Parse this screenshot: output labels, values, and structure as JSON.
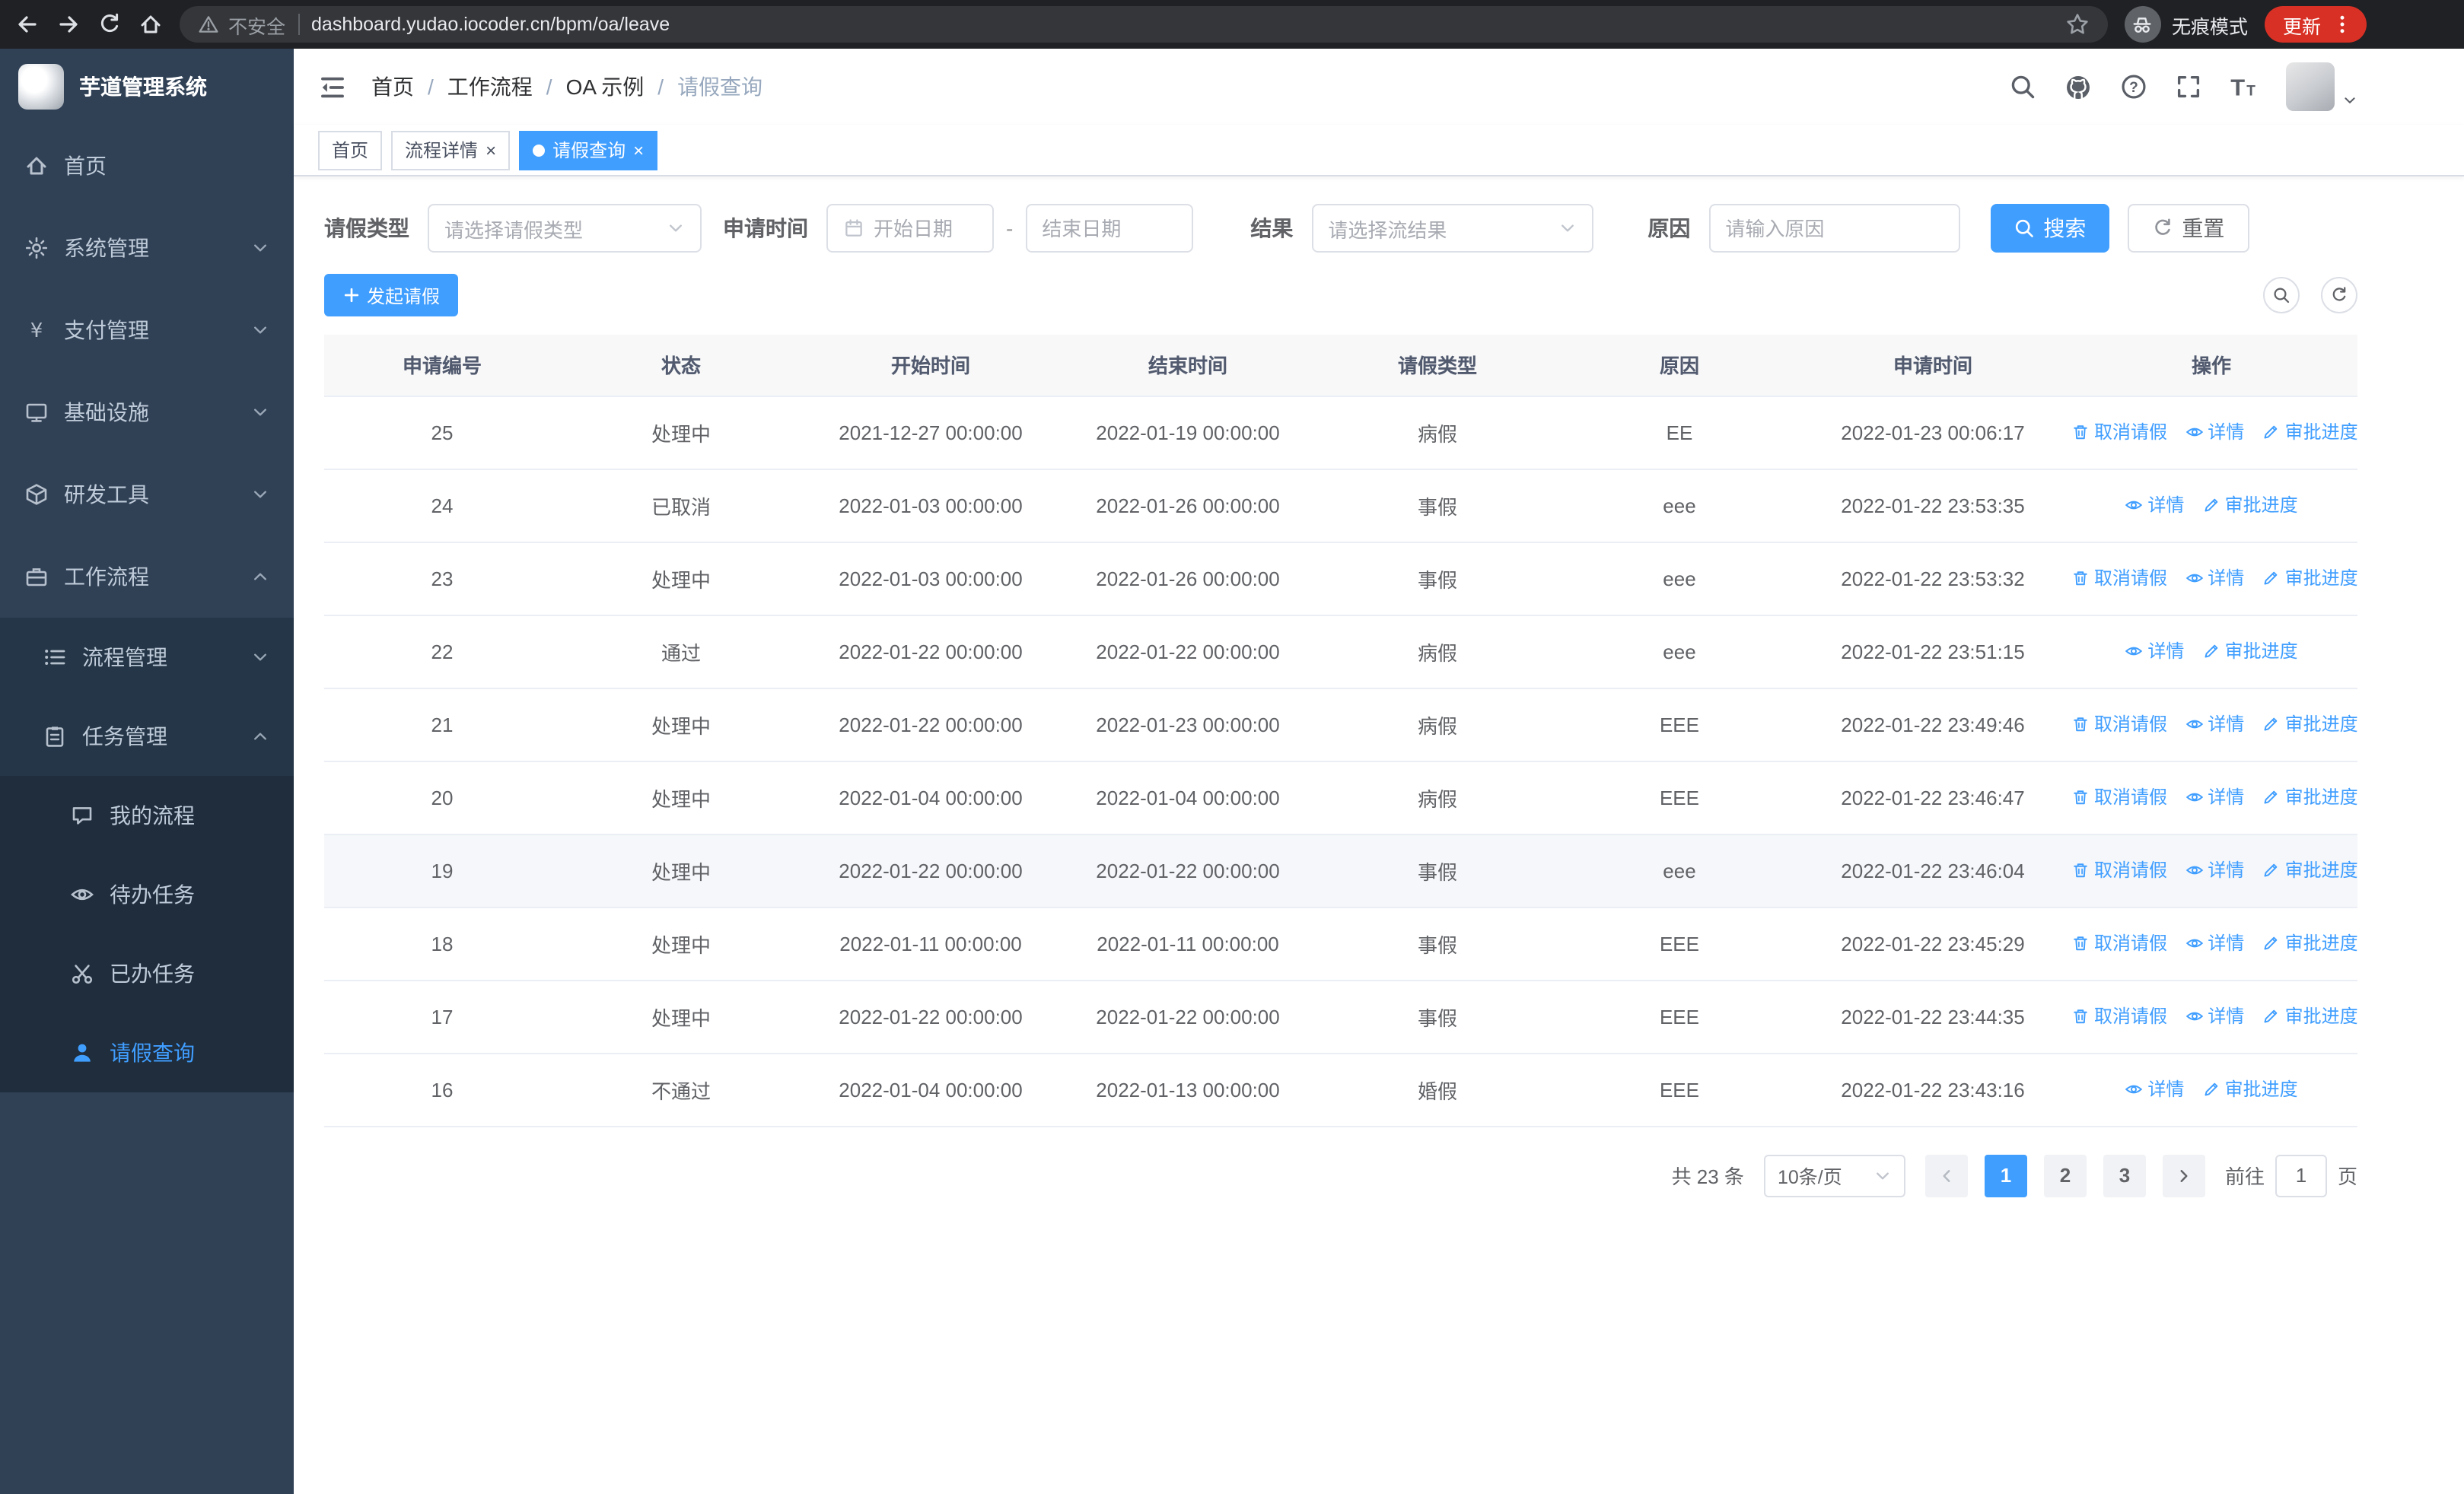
{
  "browser": {
    "security_label": "不安全",
    "url": "dashboard.yudao.iocoder.cn/bpm/oa/leave",
    "incognito_label": "无痕模式",
    "update_label": "更新"
  },
  "sidebar": {
    "logo_title": "芋道管理系统",
    "items": [
      {
        "label": "首页",
        "level": 1,
        "icon": "home-icon"
      },
      {
        "label": "系统管理",
        "level": 1,
        "icon": "gear-icon",
        "chevron": "down"
      },
      {
        "label": "支付管理",
        "level": 1,
        "icon": "yen-icon",
        "chevron": "down"
      },
      {
        "label": "基础设施",
        "level": 1,
        "icon": "monitor-icon",
        "chevron": "down"
      },
      {
        "label": "研发工具",
        "level": 1,
        "icon": "cube-icon",
        "chevron": "down"
      },
      {
        "label": "工作流程",
        "level": 1,
        "icon": "briefcase-icon",
        "chevron": "up"
      },
      {
        "label": "流程管理",
        "level": 2,
        "icon": "list-icon",
        "chevron": "down"
      },
      {
        "label": "任务管理",
        "level": 2,
        "icon": "clipboard-icon",
        "chevron": "up"
      },
      {
        "label": "我的流程",
        "level": 3,
        "icon": "chat-icon"
      },
      {
        "label": "待办任务",
        "level": 3,
        "icon": "eye-icon"
      },
      {
        "label": "已办任务",
        "level": 3,
        "icon": "scissors-icon"
      },
      {
        "label": "请假查询",
        "level": 3,
        "icon": "user-icon",
        "active": true
      }
    ]
  },
  "header": {
    "breadcrumb": [
      "首页",
      "工作流程",
      "OA 示例",
      "请假查询"
    ],
    "icons": [
      "search-icon",
      "github-icon",
      "question-icon",
      "fullscreen-icon",
      "font-size-icon",
      "avatar",
      "chevron-down-icon"
    ]
  },
  "tabs": [
    {
      "label": "首页",
      "closable": false,
      "active": false
    },
    {
      "label": "流程详情",
      "closable": true,
      "active": false
    },
    {
      "label": "请假查询",
      "closable": true,
      "active": true
    }
  ],
  "filters": {
    "leave_type": {
      "label": "请假类型",
      "placeholder": "请选择请假类型"
    },
    "apply_time": {
      "label": "申请时间",
      "start_placeholder": "开始日期",
      "separator": "-",
      "end_placeholder": "结束日期"
    },
    "result": {
      "label": "结果",
      "placeholder": "请选择流结果"
    },
    "reason": {
      "label": "原因",
      "placeholder": "请输入原因"
    },
    "search_button": "搜索",
    "reset_button": "重置"
  },
  "toolbar": {
    "create_button": "发起请假"
  },
  "table": {
    "columns": [
      "申请编号",
      "状态",
      "开始时间",
      "结束时间",
      "请假类型",
      "原因",
      "申请时间",
      "操作"
    ],
    "actions": {
      "cancel": "取消请假",
      "detail": "详情",
      "progress": "审批进度"
    },
    "rows": [
      {
        "id": "25",
        "status": "处理中",
        "start": "2021-12-27 00:00:00",
        "end": "2022-01-19 00:00:00",
        "type": "病假",
        "reason": "EE",
        "applied": "2022-01-23 00:06:17",
        "cancelable": true
      },
      {
        "id": "24",
        "status": "已取消",
        "start": "2022-01-03 00:00:00",
        "end": "2022-01-26 00:00:00",
        "type": "事假",
        "reason": "eee",
        "applied": "2022-01-22 23:53:35",
        "cancelable": false
      },
      {
        "id": "23",
        "status": "处理中",
        "start": "2022-01-03 00:00:00",
        "end": "2022-01-26 00:00:00",
        "type": "事假",
        "reason": "eee",
        "applied": "2022-01-22 23:53:32",
        "cancelable": true
      },
      {
        "id": "22",
        "status": "通过",
        "start": "2022-01-22 00:00:00",
        "end": "2022-01-22 00:00:00",
        "type": "病假",
        "reason": "eee",
        "applied": "2022-01-22 23:51:15",
        "cancelable": false
      },
      {
        "id": "21",
        "status": "处理中",
        "start": "2022-01-22 00:00:00",
        "end": "2022-01-23 00:00:00",
        "type": "病假",
        "reason": "EEE",
        "applied": "2022-01-22 23:49:46",
        "cancelable": true
      },
      {
        "id": "20",
        "status": "处理中",
        "start": "2022-01-04 00:00:00",
        "end": "2022-01-04 00:00:00",
        "type": "病假",
        "reason": "EEE",
        "applied": "2022-01-22 23:46:47",
        "cancelable": true
      },
      {
        "id": "19",
        "status": "处理中",
        "start": "2022-01-22 00:00:00",
        "end": "2022-01-22 00:00:00",
        "type": "事假",
        "reason": "eee",
        "applied": "2022-01-22 23:46:04",
        "cancelable": true,
        "highlight": true
      },
      {
        "id": "18",
        "status": "处理中",
        "start": "2022-01-11 00:00:00",
        "end": "2022-01-11 00:00:00",
        "type": "事假",
        "reason": "EEE",
        "applied": "2022-01-22 23:45:29",
        "cancelable": true
      },
      {
        "id": "17",
        "status": "处理中",
        "start": "2022-01-22 00:00:00",
        "end": "2022-01-22 00:00:00",
        "type": "事假",
        "reason": "EEE",
        "applied": "2022-01-22 23:44:35",
        "cancelable": true
      },
      {
        "id": "16",
        "status": "不通过",
        "start": "2022-01-04 00:00:00",
        "end": "2022-01-13 00:00:00",
        "type": "婚假",
        "reason": "EEE",
        "applied": "2022-01-22 23:43:16",
        "cancelable": false
      }
    ]
  },
  "pagination": {
    "total_text": "共 23 条",
    "page_size_text": "10条/页",
    "pages": [
      "1",
      "2",
      "3"
    ],
    "active_page": "1",
    "goto_label": "前往",
    "goto_value": "1",
    "goto_unit": "页"
  },
  "colors": {
    "primary": "#409eff",
    "sidebar_bg": "#304156",
    "sidebar_submenu_bg": "#1f2d3d",
    "row_hover_bg": "#f5f7fa"
  }
}
